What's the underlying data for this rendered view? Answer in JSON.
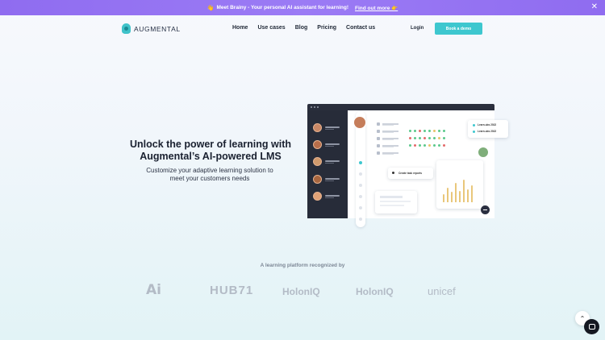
{
  "announcement": {
    "emoji": "👋",
    "text": "Meet Brainy - Your personal AI assistant for learning!",
    "link": "Find out more 👉",
    "close": "✕"
  },
  "nav": {
    "brand": "AUGMENTAL",
    "items": [
      "Home",
      "Use cases",
      "Blog",
      "Pricing",
      "Contact us"
    ],
    "login": "Login",
    "cta": "Book a demo"
  },
  "hero": {
    "title_line1": "Unlock the power of learning with",
    "title_line2": "Augmental’s AI-powered LMS",
    "subtitle_line1": "Customize your adaptive learning solution to",
    "subtitle_line2": "meet your customers needs"
  },
  "mockup": {
    "chip_learn": "Learn.ubs 2022",
    "chip_learn2": "Learn.ubs 2022",
    "create_chip": "Create task reports"
  },
  "recognition": {
    "heading": "A learning platform recognized by",
    "logos": [
      "Ai",
      "HUB71",
      "HolonIQ",
      "HolonIQ",
      "unicef"
    ]
  },
  "colors": {
    "accent": "#3ec7cf",
    "announce_bg": "#9476f2",
    "dark": "#272c39"
  }
}
